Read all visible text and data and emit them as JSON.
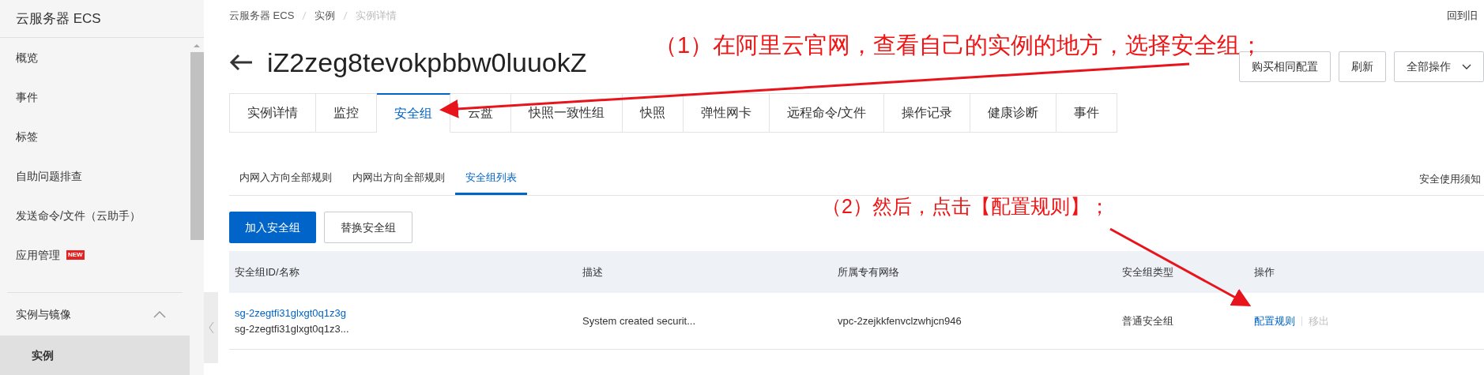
{
  "sidebar": {
    "title": "云服务器 ECS",
    "items": [
      {
        "label": "概览",
        "selected": false
      },
      {
        "label": "事件",
        "selected": false
      },
      {
        "label": "标签",
        "selected": false
      },
      {
        "label": "自助问题排查",
        "selected": false
      },
      {
        "label": "发送命令/文件（云助手）",
        "selected": false
      },
      {
        "label": "应用管理",
        "badge": "NEW",
        "selected": false
      }
    ],
    "group": {
      "label": "实例与镜像",
      "expanded": true,
      "children": [
        {
          "label": "实例",
          "selected": true
        }
      ]
    }
  },
  "breadcrumb": [
    {
      "label": "云服务器 ECS",
      "current": false
    },
    {
      "label": "实例",
      "current": false
    },
    {
      "label": "实例详情",
      "current": true
    }
  ],
  "back_to_old": "回到旧",
  "title": "iZ2zeg8tevokpbbw0luuokZ",
  "actions": [
    {
      "label": "购买相同配置",
      "dropdown": false
    },
    {
      "label": "刷新",
      "dropdown": false
    },
    {
      "label": "全部操作",
      "dropdown": true
    }
  ],
  "tabs": [
    {
      "label": "实例详情",
      "selected": false
    },
    {
      "label": "监控",
      "selected": false
    },
    {
      "label": "安全组",
      "selected": true
    },
    {
      "label": "云盘",
      "selected": false
    },
    {
      "label": "快照一致性组",
      "selected": false
    },
    {
      "label": "快照",
      "selected": false
    },
    {
      "label": "弹性网卡",
      "selected": false
    },
    {
      "label": "远程命令/文件",
      "selected": false
    },
    {
      "label": "操作记录",
      "selected": false
    },
    {
      "label": "健康诊断",
      "selected": false
    },
    {
      "label": "事件",
      "selected": false
    }
  ],
  "subtabs": [
    {
      "label": "内网入方向全部规则",
      "selected": false
    },
    {
      "label": "内网出方向全部规则",
      "selected": false
    },
    {
      "label": "安全组列表",
      "selected": true
    }
  ],
  "security_notice": "安全使用须知",
  "buttons": [
    {
      "label": "加入安全组",
      "primary": true
    },
    {
      "label": "替换安全组",
      "primary": false
    }
  ],
  "table": {
    "columns": [
      "安全组ID/名称",
      "描述",
      "所属专有网络",
      "安全组类型",
      "操作"
    ],
    "rows": [
      {
        "id": "sg-2zegtfi31glxgt0q1z3g",
        "name": "sg-2zegtfi31glxgt0q1z3...",
        "description": "System created securit...",
        "vpc": "vpc-2zejkkfenvclzwhjcn946",
        "type": "普通安全组",
        "actions": [
          {
            "label": "配置规则",
            "disabled": false
          },
          {
            "label": "移出",
            "disabled": true
          }
        ]
      }
    ]
  },
  "annotations": [
    "（1）在阿里云官网，查看自己的实例的地方，选择安全组；",
    "（2）然后，点击【配置规则】；"
  ]
}
